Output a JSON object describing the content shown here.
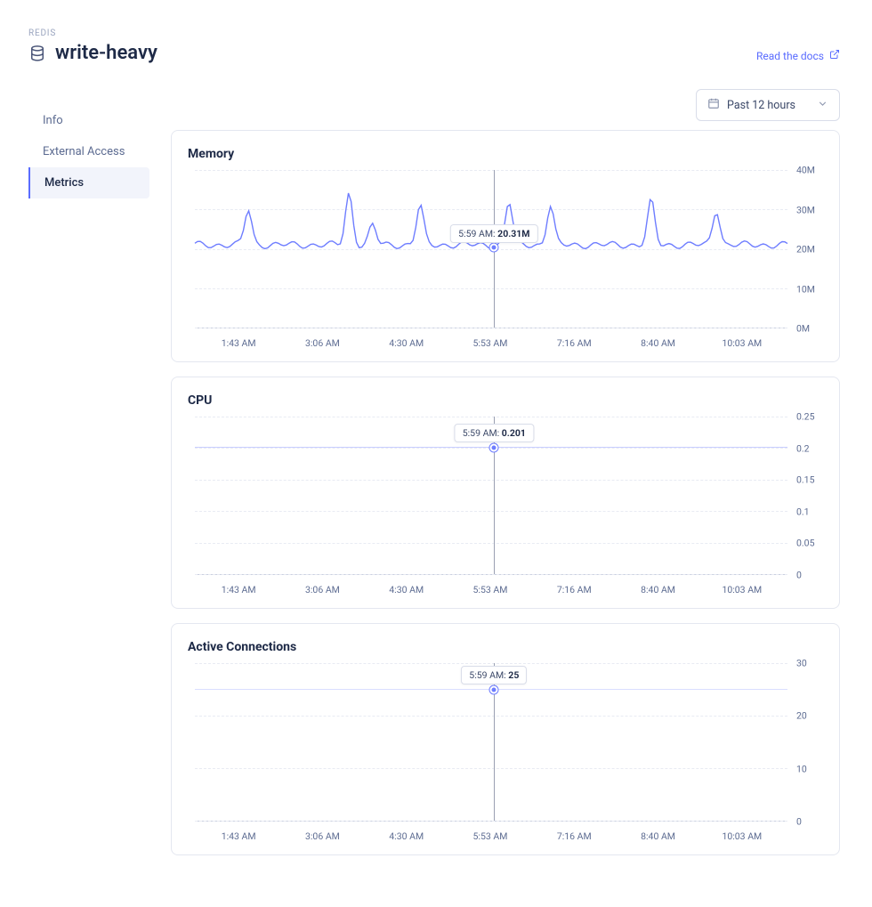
{
  "breadcrumb": "REDIS",
  "title": "write-heavy",
  "docs_link": "Read the docs",
  "sidebar": {
    "items": [
      {
        "label": "Info"
      },
      {
        "label": "External Access"
      },
      {
        "label": "Metrics"
      }
    ]
  },
  "time_select": {
    "label": "Past 12 hours"
  },
  "chart_data": [
    {
      "id": "memory",
      "title": "Memory",
      "type": "line",
      "x_ticks": [
        "1:43 AM",
        "3:06 AM",
        "4:30 AM",
        "5:53 AM",
        "7:16 AM",
        "8:40 AM",
        "10:03 AM"
      ],
      "y_ticks": [
        "0M",
        "10M",
        "20M",
        "30M",
        "40M"
      ],
      "ylim": [
        0,
        40
      ],
      "unit": "M",
      "baseline": 21,
      "spikes": [
        {
          "x": 0.09,
          "h": 30
        },
        {
          "x": 0.26,
          "h": 34
        },
        {
          "x": 0.3,
          "h": 26
        },
        {
          "x": 0.38,
          "h": 31
        },
        {
          "x": 0.53,
          "h": 32
        },
        {
          "x": 0.6,
          "h": 31
        },
        {
          "x": 0.77,
          "h": 32
        },
        {
          "x": 0.88,
          "h": 30
        }
      ],
      "tooltip": {
        "time": "5:59 AM",
        "value": "20.31M",
        "x_frac": 0.505,
        "y_val": 20.31
      }
    },
    {
      "id": "cpu",
      "title": "CPU",
      "type": "line",
      "x_ticks": [
        "1:43 AM",
        "3:06 AM",
        "4:30 AM",
        "5:53 AM",
        "7:16 AM",
        "8:40 AM",
        "10:03 AM"
      ],
      "y_ticks": [
        "0",
        "0.05",
        "0.1",
        "0.15",
        "0.2",
        "0.25"
      ],
      "ylim": [
        0,
        0.25
      ],
      "flat_value": 0.201,
      "tooltip": {
        "time": "5:59 AM",
        "value": "0.201",
        "x_frac": 0.505,
        "y_val": 0.201
      }
    },
    {
      "id": "connections",
      "title": "Active Connections",
      "type": "line",
      "x_ticks": [
        "1:43 AM",
        "3:06 AM",
        "4:30 AM",
        "5:53 AM",
        "7:16 AM",
        "8:40 AM",
        "10:03 AM"
      ],
      "y_ticks": [
        "0",
        "10",
        "20",
        "30"
      ],
      "ylim": [
        0,
        30
      ],
      "flat_value": 25,
      "tooltip": {
        "time": "5:59 AM",
        "value": "25",
        "x_frac": 0.505,
        "y_val": 25
      }
    }
  ],
  "chart_heights": {
    "memory": 178,
    "cpu": 178,
    "connections": 178
  }
}
